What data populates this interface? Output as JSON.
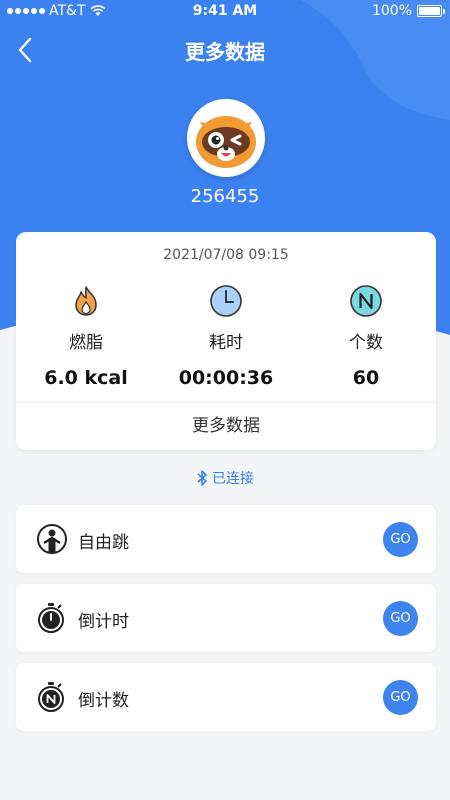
{
  "status_bar": {
    "carrier": "AT&T",
    "time": "9:41 AM",
    "battery_text": "100%",
    "battery_level": 1.0
  },
  "nav": {
    "back_icon": "chevron-left-icon",
    "title": "更多数据"
  },
  "profile": {
    "avatar_icon": "raccoon-mascot-icon",
    "user_id": "256455"
  },
  "stats": {
    "date": "2021/07/08 09:15",
    "items": [
      {
        "icon": "flame-icon",
        "label": "燃脂",
        "value": "6.0 kcal"
      },
      {
        "icon": "clock-icon",
        "label": "耗时",
        "value": "00:00:36"
      },
      {
        "icon": "count-n-icon",
        "label": "个数",
        "value": "60"
      }
    ],
    "more_label": "更多数据"
  },
  "connection": {
    "icon": "bluetooth-icon",
    "text": "已连接"
  },
  "modes": [
    {
      "icon": "jump-rope-person-icon",
      "label": "自由跳",
      "go": "GO"
    },
    {
      "icon": "stopwatch-icon",
      "label": "倒计时",
      "go": "GO"
    },
    {
      "icon": "stopwatch-n-icon",
      "label": "倒计数",
      "go": "GO"
    }
  ],
  "colors": {
    "primary_blue": "#3d85ec",
    "header_blue": "#3b82f0",
    "background": "#f4f5f7",
    "flame_orange": "#f08a2c",
    "clock_blue": "#9fc8f5",
    "count_cyan": "#5fd3e0"
  }
}
